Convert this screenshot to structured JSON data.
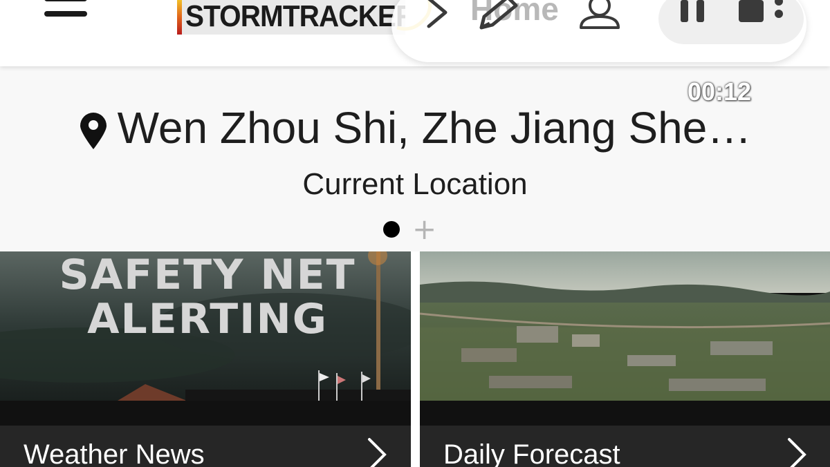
{
  "header": {
    "logo_text": "STORMTRACKER",
    "menu_icon": "hamburger-menu-icon"
  },
  "overlay": {
    "home_label": "Home",
    "icons": [
      "chevron-right-icon",
      "pen-icon",
      "person-icon",
      "pause-icon",
      "stop-icon",
      "more-icon"
    ],
    "timer": "00:12"
  },
  "location": {
    "name": "Wen Zhou Shi, Zhe Jiang She…",
    "subtitle": "Current Location",
    "pin_icon": "location-pin-icon",
    "add_icon_glyph": "+"
  },
  "cards": [
    {
      "image_text_line1": "SAFETY NET",
      "image_text_line2": "ALERTING",
      "title": "Weather News"
    },
    {
      "title": "Daily Forecast"
    }
  ],
  "colors": {
    "header_bg": "#ffffff",
    "panel_bg": "#f8f8f8",
    "card_footer_bg": "#262626"
  }
}
